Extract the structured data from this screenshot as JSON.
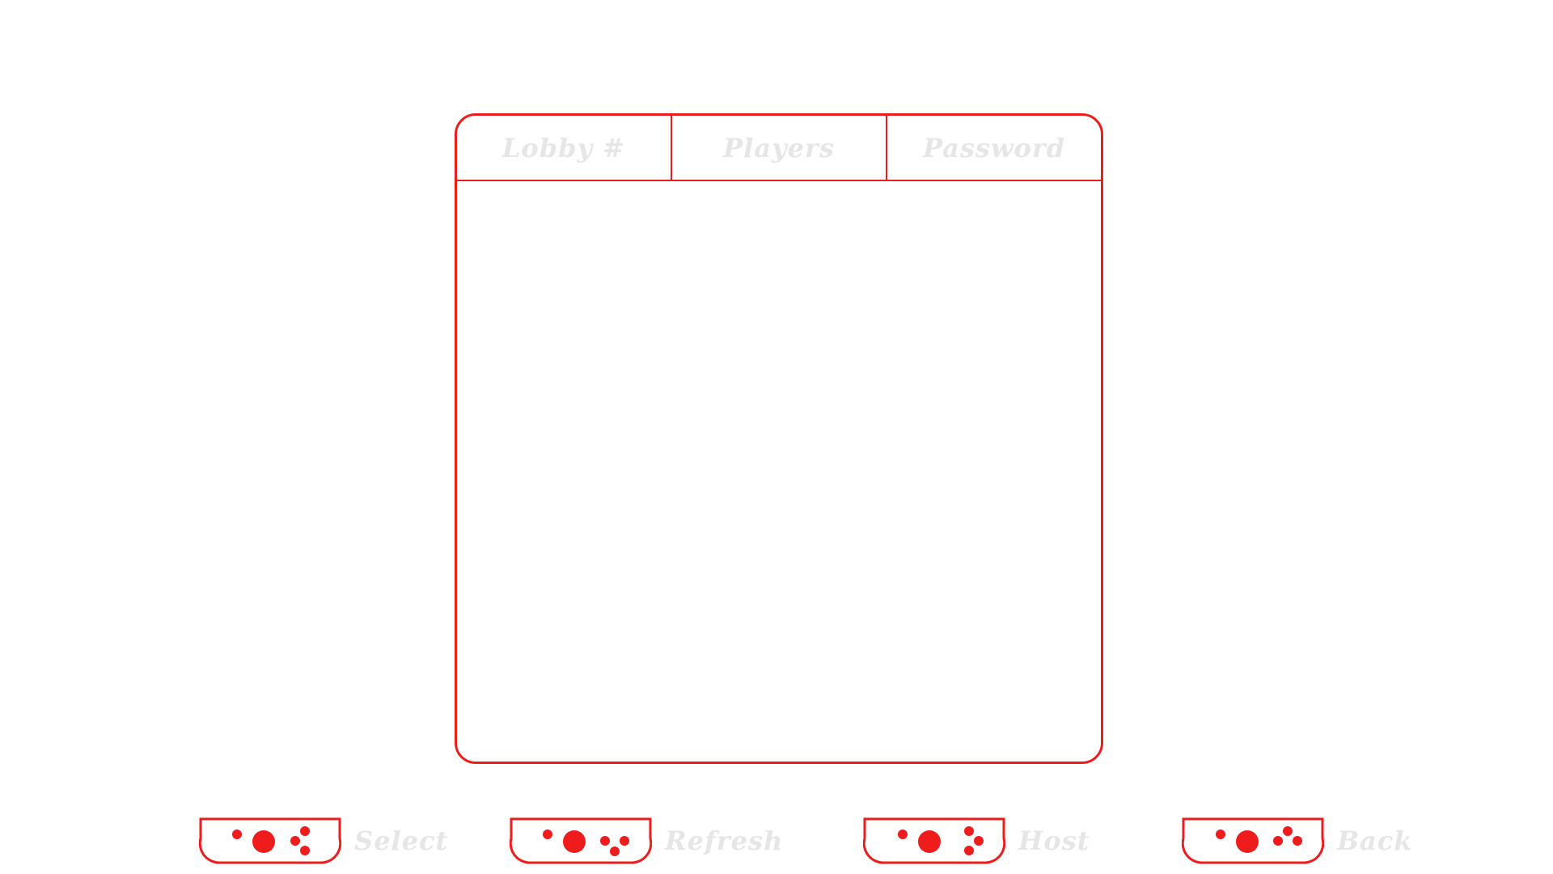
{
  "lobby_table": {
    "columns": [
      {
        "label": "Lobby #"
      },
      {
        "label": "Players"
      },
      {
        "label": "Password"
      }
    ],
    "rows": []
  },
  "prompts": [
    {
      "label": "Select",
      "icon": "controller-icon"
    },
    {
      "label": "Refresh",
      "icon": "controller-icon"
    },
    {
      "label": "Host",
      "icon": "controller-icon"
    },
    {
      "label": "Back",
      "icon": "controller-icon"
    }
  ],
  "colors": {
    "accent": "#ee1c1c",
    "label": "#e6e6e6",
    "background": "#ffffff"
  }
}
